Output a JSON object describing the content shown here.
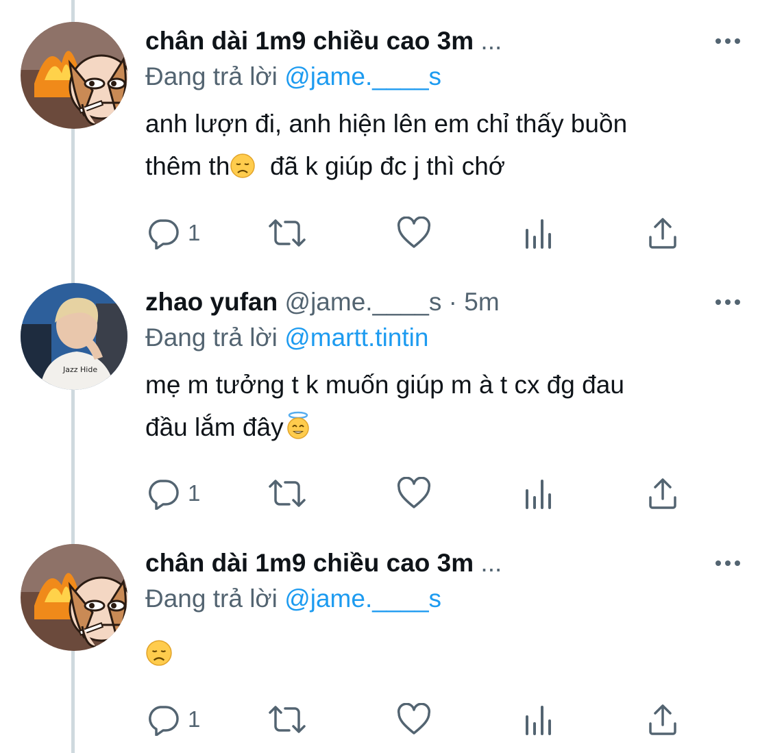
{
  "tweets": [
    {
      "name": "chân dài 1m9 chiều cao 3m",
      "handle": "",
      "time": "",
      "truncation": "...",
      "replying_label": "Đang trả lời",
      "replying_to": "@jame.____s",
      "body_line1": "anh lượn đi, anh hiện lên em chỉ thấy buồn",
      "body_line2_a": "thêm th",
      "body_line2_emoji": "disappointed-face",
      "body_line2_b": "  đã k giúp đc j thì chớ",
      "replies": "1",
      "avatar": "cartoon-dog-smoking-fire"
    },
    {
      "name": "zhao yufan",
      "handle": "@jame.____s",
      "separator": "·",
      "time": "5m",
      "replying_label": "Đang trả lời",
      "replying_to": "@martt.tintin",
      "body_line1": "mẹ m tưởng t k muốn giúp m à t cx đg đau",
      "body_line2_a": "đầu lắm đây",
      "body_line2_emoji": "smiling-face-with-halo",
      "replies": "1",
      "avatar": "photo-young-man"
    },
    {
      "name": "chân dài 1m9 chiều cao 3m",
      "truncation": "...",
      "replying_label": "Đang trả lời",
      "replying_to": "@jame.____s",
      "body_emoji": "disappointed-face",
      "replies": "1",
      "avatar": "cartoon-dog-smoking-fire"
    }
  ],
  "icons": {
    "more": "more-icon",
    "reply": "reply-icon",
    "retweet": "retweet-icon",
    "like": "like-icon",
    "views": "views-icon",
    "share": "share-icon"
  },
  "colors": {
    "text": "#0f1419",
    "secondary": "#536471",
    "link": "#1d9bf0",
    "thread": "#cfd9de"
  }
}
